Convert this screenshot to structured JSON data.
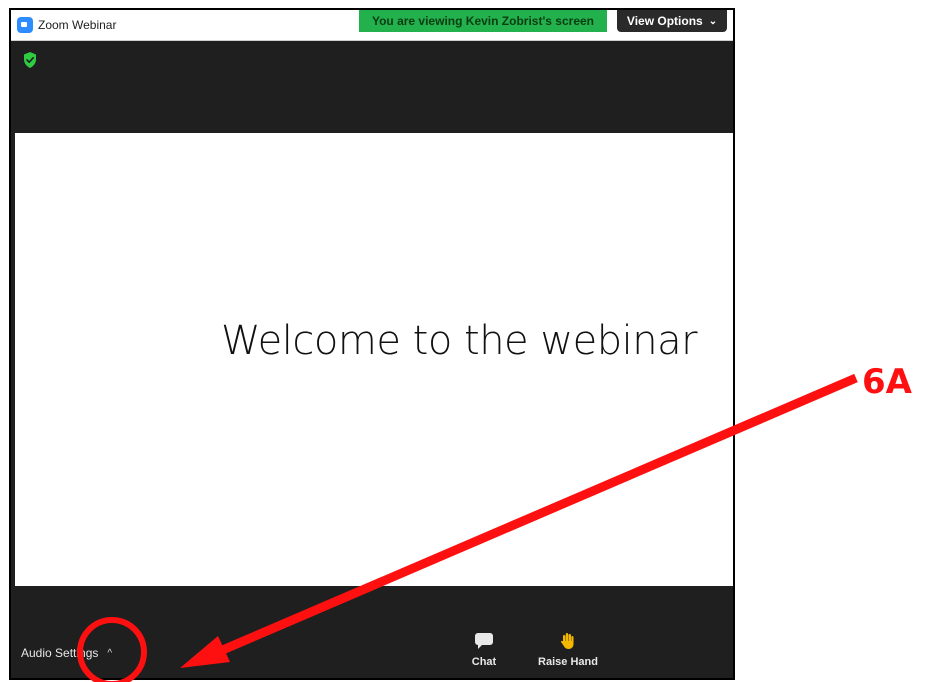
{
  "window": {
    "title": "Zoom Webinar",
    "app_icon": "zoom-camera-icon"
  },
  "banner": {
    "viewing_text": "You are viewing Kevin Zobrist's screen",
    "viewing_color": "#22b14c",
    "view_options_label": "View Options",
    "view_options_icon": "chevron-down-icon"
  },
  "security": {
    "icon": "shield-check-icon",
    "color": "#2ecc40"
  },
  "slide": {
    "text": "Welcome to the webinar"
  },
  "toolbar": {
    "audio_settings_label": "Audio Settings",
    "audio_settings_icon": "caret-up-icon",
    "chat_label": "Chat",
    "chat_icon": "chat-bubble-icon",
    "raise_hand_label": "Raise Hand",
    "raise_hand_icon": "hand-icon"
  },
  "annotation": {
    "label": "6A",
    "color": "#ff1010"
  }
}
